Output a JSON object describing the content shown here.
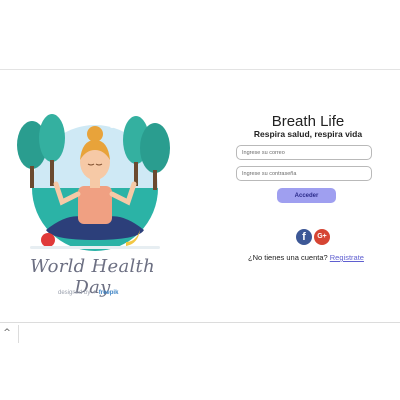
{
  "illustration": {
    "caption": "World Health Day",
    "credit": "designed by",
    "credit_brand": "freepik"
  },
  "login": {
    "title": "Breath Life",
    "tagline": "Respira salud, respira vida",
    "email_placeholder": "Ingrese su correo",
    "password_placeholder": "Ingrese su contraseña",
    "submit_label": "Acceder",
    "social": [
      {
        "name": "facebook-icon",
        "glyph": "f",
        "color": "#3d5896"
      },
      {
        "name": "google-plus-icon",
        "glyph": "G+",
        "color": "#d64533"
      }
    ],
    "signup_prompt": "¿No tienes una cuenta?",
    "signup_link": "Registrate"
  },
  "bottom_bar": {
    "scroll_glyph": "^"
  }
}
